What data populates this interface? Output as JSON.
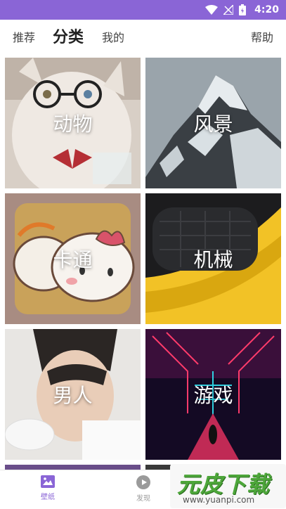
{
  "status_bar": {
    "time": "4:20"
  },
  "top_nav": {
    "tabs": [
      {
        "label": "推荐",
        "active": false
      },
      {
        "label": "分类",
        "active": true
      },
      {
        "label": "我的",
        "active": false
      }
    ],
    "help_label": "帮助"
  },
  "categories": [
    {
      "label": "动物"
    },
    {
      "label": "风景"
    },
    {
      "label": "卡通"
    },
    {
      "label": "机械"
    },
    {
      "label": "男人"
    },
    {
      "label": "游戏"
    }
  ],
  "bottom_nav": {
    "items": [
      {
        "label": "壁纸",
        "active": true
      },
      {
        "label": "发现",
        "active": false
      }
    ]
  },
  "watermark": {
    "brand": "元皮下载",
    "url": "www.yuanpi.com"
  },
  "colors": {
    "accent": "#8a65d6",
    "bottom_active": "#8a65d6",
    "bottom_inactive": "#9a9a9a"
  }
}
